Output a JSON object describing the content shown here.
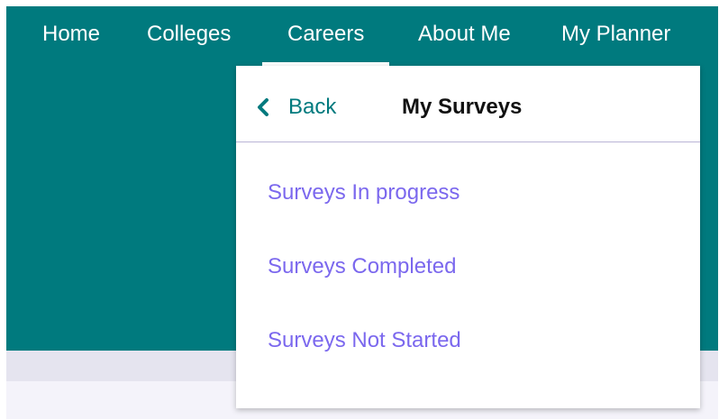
{
  "theme": {
    "brand_color": "#007a7e",
    "accent_color": "#7b68ee"
  },
  "nav": {
    "items": [
      {
        "label": "Home"
      },
      {
        "label": "Colleges"
      },
      {
        "label": "Careers",
        "active": true
      },
      {
        "label": "About Me"
      },
      {
        "label": "My Planner"
      }
    ]
  },
  "dropdown": {
    "back_icon": "chevron-left-icon",
    "back_label": "Back",
    "title": "My Surveys",
    "links": [
      {
        "label": "Surveys In progress"
      },
      {
        "label": "Surveys Completed"
      },
      {
        "label": "Surveys Not Started"
      }
    ]
  }
}
